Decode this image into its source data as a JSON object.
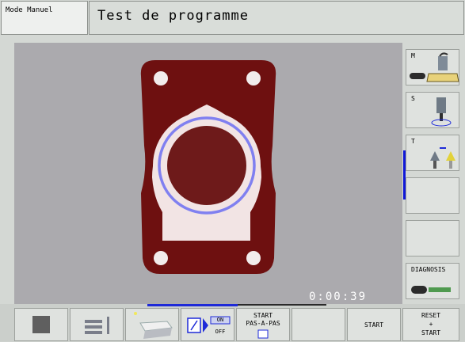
{
  "header": {
    "mode_label": "Mode Manuel",
    "title": "Test de programme"
  },
  "graphics": {
    "timer": "0:00:39",
    "part_color": "#6e1010",
    "contour_color": "#8080f0"
  },
  "right_softkeys": {
    "m_label": "M",
    "s_label": "S",
    "t_label": "T",
    "diagnosis_label": "DIAGNOSIS"
  },
  "bottom_softkeys": {
    "on_label": "ON",
    "off_label": "OFF",
    "start_step_line1": "START",
    "start_step_line2": "PAS-A-PAS",
    "start_label": "START",
    "reset_line1": "RESET",
    "reset_line2": "+",
    "reset_line3": "START"
  },
  "colors": {
    "accent": "#1e2ad8",
    "background": "#abaaae"
  }
}
